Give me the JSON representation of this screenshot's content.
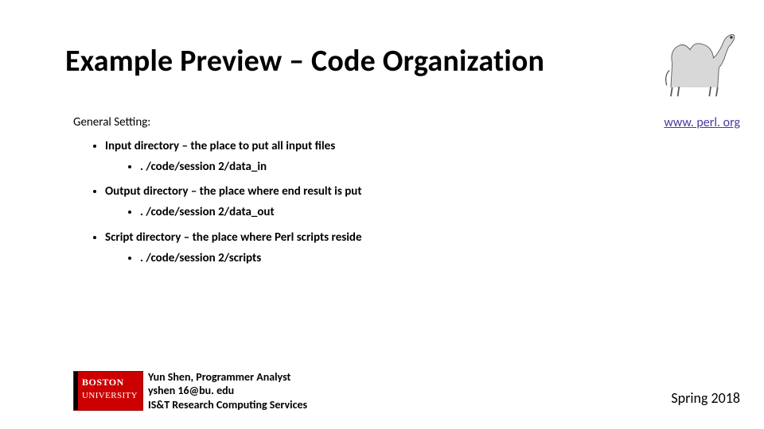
{
  "title": "Example Preview – Code Organization",
  "general_label": "General Setting:",
  "items": [
    {
      "heading": "Input directory – the place to put all input files",
      "path": ". /code/session 2/data_in"
    },
    {
      "heading": "Output directory – the place where end result is put",
      "path": ". /code/session 2/data_out"
    },
    {
      "heading": "Script directory – the place where Perl scripts reside",
      "path": ". /code/session 2/scripts"
    }
  ],
  "link": {
    "text": "www. perl. org"
  },
  "author": {
    "name": "Yun Shen, Programmer Analyst",
    "email": "yshen 16@bu. edu",
    "dept": "IS&T Research Computing Services"
  },
  "bu_logo": {
    "line1": "BOSTON",
    "line2": "UNIVERSITY"
  },
  "term": "Spring 2018"
}
